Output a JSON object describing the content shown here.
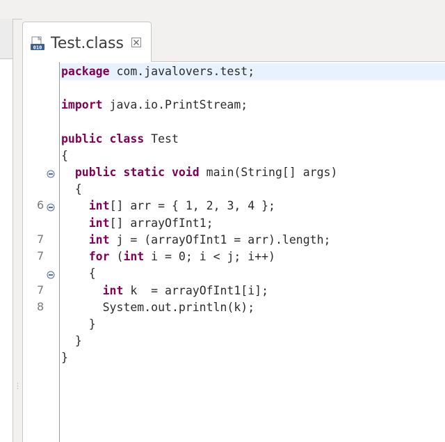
{
  "tab": {
    "title": "Test.class",
    "icon": "class-file-icon",
    "close_icon": "close-icon"
  },
  "colors": {
    "keyword": "#7f0055",
    "current_line": "#e8f2fe",
    "text": "#2b2b2b",
    "line_number": "#787878"
  },
  "code_lines": [
    {
      "k1": "package",
      "t1": " com.javalovers.test;"
    },
    {},
    {
      "k1": "import",
      "t1": " java.io.PrintStream;"
    },
    {},
    {
      "k1": "public",
      "t1": " ",
      "k2": "class",
      "t2": " Test"
    },
    {
      "t1": "{"
    },
    {
      "t0": "  ",
      "k1": "public",
      "t1": " ",
      "k2": "static",
      "t2": " ",
      "k3": "void",
      "t3": " main(String[] args)"
    },
    {
      "t1": "  {"
    },
    {
      "t0": "    ",
      "k1": "int",
      "t1": "[] arr = { 1, 2, 3, 4 };"
    },
    {
      "t0": "    ",
      "k1": "int",
      "t1": "[] arrayOfInt1;"
    },
    {
      "t0": "    ",
      "k1": "int",
      "t1": " j = (arrayOfInt1 = arr).length;"
    },
    {
      "t0": "    ",
      "k1": "for",
      "t1": " (",
      "k2": "int",
      "t2": " i = 0; i < j; i++)"
    },
    {
      "t1": "    {"
    },
    {
      "t0": "      ",
      "k1": "int",
      "t1": " k  = arrayOfInt1[i];"
    },
    {
      "t1": "      System.out.println(k);"
    },
    {
      "t1": "    }"
    },
    {
      "t1": "  }"
    },
    {
      "t1": "}"
    }
  ],
  "line_numbers": {
    "n8": "6",
    "n10": "7",
    "n11": "7",
    "n13": "7",
    "n14": "8"
  }
}
